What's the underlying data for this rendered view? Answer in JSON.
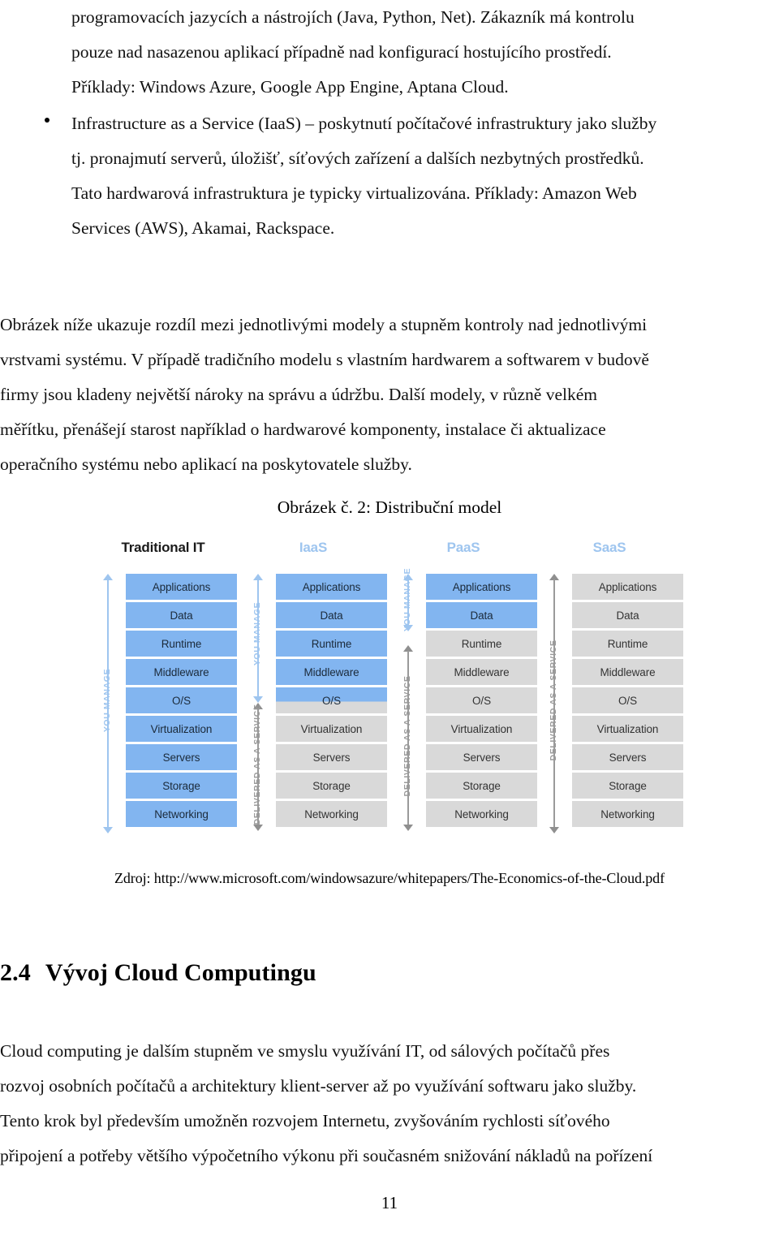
{
  "document": {
    "page_number": "11",
    "body": {
      "paragraph_1_lines": [
        "programovacích jazycích a nástrojích (Java, Python, Net). Zákazník má kontrolu",
        "pouze nad nasazenou aplikací případně nad konfigurací hostujícího prostředí.",
        "Příklady: Windows Azure, Google App Engine, Aptana Cloud."
      ],
      "bullet_item": {
        "bullet_glyph": "•",
        "lines": [
          "Infrastructure as a Service (IaaS) – poskytnutí počítačové infrastruktury jako služby",
          "tj. pronajmutí serverů, úložišť, síťových zařízení a dalších nezbytných prostředků.",
          "Tato hardwarová infrastruktura je typicky virtualizována. Příklady: Amazon Web",
          "Services (AWS), Akamai, Rackspace."
        ]
      },
      "paragraph_2_lines": [
        "Obrázek níže ukazuje rozdíl mezi jednotlivými modely a stupněm kontroly nad jednotlivými",
        "vrstvami systému. V případě tradičního modelu s vlastním hardwarem a softwarem v budově",
        "firmy jsou kladeny největší nároky na správu a údržbu. Další modely, v různě velkém",
        "měřítku, přenášejí starost například o hardwarové komponenty, instalace či aktualizace",
        "operačního systému nebo aplikací na poskytovatele služby."
      ],
      "figure_caption": "Obrázek č. 2: Distribuční model",
      "figure_source": "Zdroj: http://www.microsoft.com/windowsazure/whitepapers/The-Economics-of-the-Cloud.pdf",
      "section_heading": {
        "number": "2.4",
        "title": "Vývoj Cloud Computingu"
      },
      "paragraph_3_lines": [
        "Cloud computing je dalším stupněm ve smyslu využívání IT, od sálových počítačů přes",
        "rozvoj osobních počítačů a architektury klient-server až po využívání softwaru jako služby.",
        "Tento krok byl především umožněn rozvojem Internetu, zvyšováním rychlosti síťového",
        "připojení a potřeby většího výpočetního výkonu při současném snižování nákladů na pořízení"
      ]
    }
  },
  "figure": {
    "colors": {
      "managed_blue": "#82b5f0",
      "service_gray": "#d9d9d9",
      "label_blue": "#9ec5ef",
      "label_gray": "#9a9a9a"
    },
    "labels": {
      "you_manage": "YOU MANAGE",
      "delivered_as_a_service": "DELIVERED AS A SERVICE"
    },
    "layer_names": [
      "Applications",
      "Data",
      "Runtime",
      "Middleware",
      "O/S",
      "Virtualization",
      "Servers",
      "Storage",
      "Networking"
    ],
    "columns": [
      {
        "title": "Traditional IT",
        "title_style": "strong",
        "layers": [
          {
            "name": "Applications",
            "state": "managed"
          },
          {
            "name": "Data",
            "state": "managed"
          },
          {
            "name": "Runtime",
            "state": "managed"
          },
          {
            "name": "Middleware",
            "state": "managed"
          },
          {
            "name": "O/S",
            "state": "managed"
          },
          {
            "name": "Virtualization",
            "state": "managed"
          },
          {
            "name": "Servers",
            "state": "managed"
          },
          {
            "name": "Storage",
            "state": "managed"
          },
          {
            "name": "Networking",
            "state": "managed"
          }
        ],
        "you_manage_layers": 9,
        "delivered_layers": 0
      },
      {
        "title": "IaaS",
        "title_style": "dim",
        "layers": [
          {
            "name": "Applications",
            "state": "managed"
          },
          {
            "name": "Data",
            "state": "managed"
          },
          {
            "name": "Runtime",
            "state": "managed"
          },
          {
            "name": "Middleware",
            "state": "managed"
          },
          {
            "name": "O/S",
            "state": "split"
          },
          {
            "name": "Virtualization",
            "state": "service"
          },
          {
            "name": "Servers",
            "state": "service"
          },
          {
            "name": "Storage",
            "state": "service"
          },
          {
            "name": "Networking",
            "state": "service"
          }
        ],
        "you_manage_layers": 5,
        "delivered_layers": 5
      },
      {
        "title": "PaaS",
        "title_style": "dim",
        "layers": [
          {
            "name": "Applications",
            "state": "managed"
          },
          {
            "name": "Data",
            "state": "managed"
          },
          {
            "name": "Runtime",
            "state": "service"
          },
          {
            "name": "Middleware",
            "state": "service"
          },
          {
            "name": "O/S",
            "state": "service"
          },
          {
            "name": "Virtualization",
            "state": "service"
          },
          {
            "name": "Servers",
            "state": "service"
          },
          {
            "name": "Storage",
            "state": "service"
          },
          {
            "name": "Networking",
            "state": "service"
          }
        ],
        "you_manage_layers": 2,
        "delivered_layers": 7
      },
      {
        "title": "SaaS",
        "title_style": "dim",
        "layers": [
          {
            "name": "Applications",
            "state": "service"
          },
          {
            "name": "Data",
            "state": "service"
          },
          {
            "name": "Runtime",
            "state": "service"
          },
          {
            "name": "Middleware",
            "state": "service"
          },
          {
            "name": "O/S",
            "state": "service"
          },
          {
            "name": "Virtualization",
            "state": "service"
          },
          {
            "name": "Servers",
            "state": "service"
          },
          {
            "name": "Storage",
            "state": "service"
          },
          {
            "name": "Networking",
            "state": "service"
          }
        ],
        "you_manage_layers": 0,
        "delivered_layers": 9
      }
    ]
  }
}
